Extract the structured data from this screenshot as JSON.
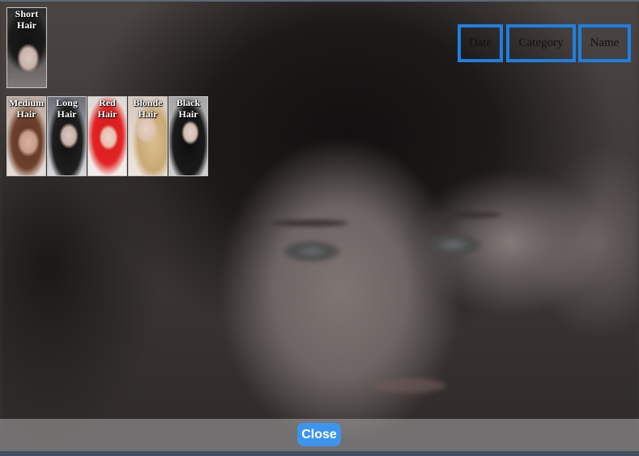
{
  "featured": {
    "label": "Short Hair"
  },
  "categories": [
    {
      "label": "Medium Hair"
    },
    {
      "label": "Long Hair"
    },
    {
      "label": "Red Hair"
    },
    {
      "label": "Blonde Hair"
    },
    {
      "label": "Black Hair"
    }
  ],
  "sort_buttons": {
    "first": "Date",
    "category": "Category",
    "name": "Name"
  },
  "footer": {
    "close_label": "Close"
  },
  "colors": {
    "accent": "#1e7fe0",
    "close_button": "#3d94ee"
  }
}
